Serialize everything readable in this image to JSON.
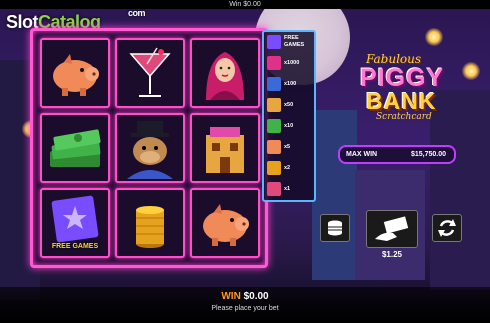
{
  "topbar": {
    "win_text": "Win $0.00"
  },
  "watermark": {
    "part1": "Slot",
    "part2": "Catalog",
    "suffix": "com"
  },
  "grid": {
    "cells": [
      {
        "symbol": "piggy-bank",
        "label": ""
      },
      {
        "symbol": "cocktail",
        "label": ""
      },
      {
        "symbol": "lady",
        "label": ""
      },
      {
        "symbol": "cash-stack",
        "label": ""
      },
      {
        "symbol": "bulldog-boss",
        "label": ""
      },
      {
        "symbol": "casino-building",
        "label": ""
      },
      {
        "symbol": "free-games",
        "label": "FREE GAMES"
      },
      {
        "symbol": "coin-stack",
        "label": ""
      },
      {
        "symbol": "piggy-bank",
        "label": ""
      }
    ]
  },
  "paytable": {
    "rows": [
      {
        "icon": "free-games",
        "text": "FREE GAMES",
        "color": "#7a4cff"
      },
      {
        "icon": "lady",
        "text": "x1000",
        "color": "#e0308a"
      },
      {
        "icon": "bulldog-boss",
        "text": "x100",
        "color": "#3a6ad8"
      },
      {
        "icon": "casino-building",
        "text": "x50",
        "color": "#e7a640"
      },
      {
        "icon": "cash-stack",
        "text": "x10",
        "color": "#3fb24a"
      },
      {
        "icon": "piggy-bank",
        "text": "x5",
        "color": "#f08a58"
      },
      {
        "icon": "coin-stack",
        "text": "x2",
        "color": "#e6a21c"
      },
      {
        "icon": "cocktail",
        "text": "x1",
        "color": "#e04a7a"
      }
    ]
  },
  "title": {
    "line1": "Fabulous",
    "line2": "PIGGY",
    "line3": "BANK",
    "line4": "Scratchcard"
  },
  "max_win": {
    "label": "MAX WIN",
    "value": "$15,750.00"
  },
  "controls": {
    "bet_value": "$1.25"
  },
  "status": {
    "win_label": "WIN",
    "win_value": "$0.00",
    "hint": "Please place your bet"
  },
  "colors": {
    "accent": "#ff4fc8",
    "win": "#ff9a1e",
    "maxwin_border": "#c23cff"
  }
}
